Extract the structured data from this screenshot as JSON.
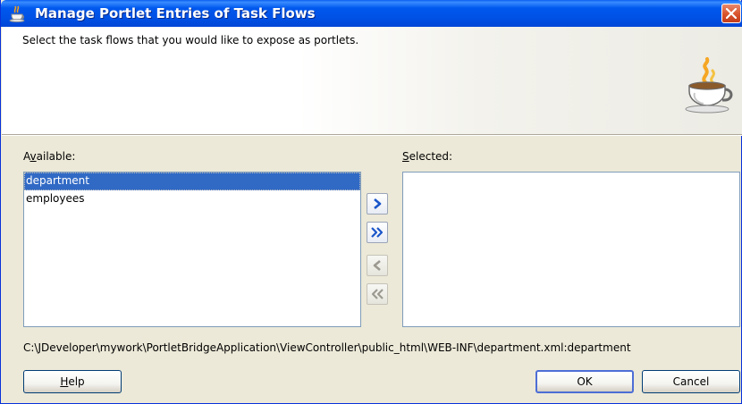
{
  "dialog": {
    "title": "Manage Portlet Entries of Task Flows",
    "description": "Select the task flows that you would like to expose as portlets."
  },
  "available": {
    "label_pre": "A",
    "label_mnemonic": "v",
    "label_post": "ailable:",
    "items": [
      "department",
      "employees"
    ],
    "selected_index": 0
  },
  "selected": {
    "label_mnemonic": "S",
    "label_post": "elected:",
    "items": []
  },
  "shuttle": {
    "move_enabled": true,
    "move_all_enabled": true,
    "remove_enabled": false,
    "remove_all_enabled": false
  },
  "path": "C:\\JDeveloper\\mywork\\PortletBridgeApplication\\ViewController\\public_html\\WEB-INF\\department.xml:department",
  "buttons": {
    "help_mnemonic": "H",
    "help_post": "elp",
    "ok": "OK",
    "cancel": "Cancel"
  },
  "colors": {
    "titlebar": "#0054e3",
    "selection": "#316ac5",
    "close": "#d8532c"
  }
}
